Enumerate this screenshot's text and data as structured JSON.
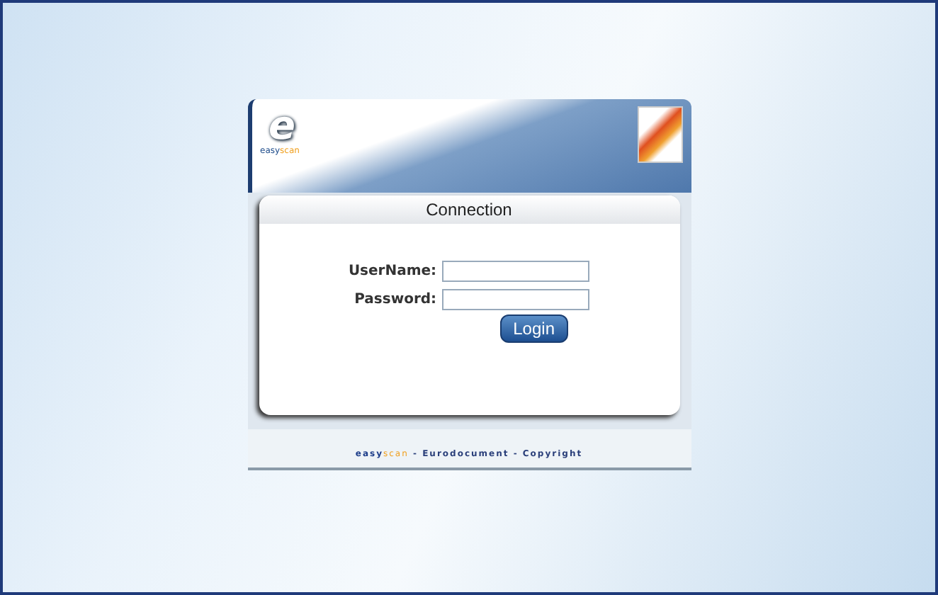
{
  "header": {
    "logo_letter": "e",
    "logo_words": [
      "easy",
      "scan"
    ]
  },
  "panel": {
    "title": "Connection",
    "fields": [
      {
        "label": "UserName:"
      },
      {
        "label": "Password:"
      }
    ],
    "button": "Login"
  },
  "footer": {
    "brand": [
      "easy",
      "scan"
    ],
    "text": "- Eurodocument - Copyright"
  }
}
